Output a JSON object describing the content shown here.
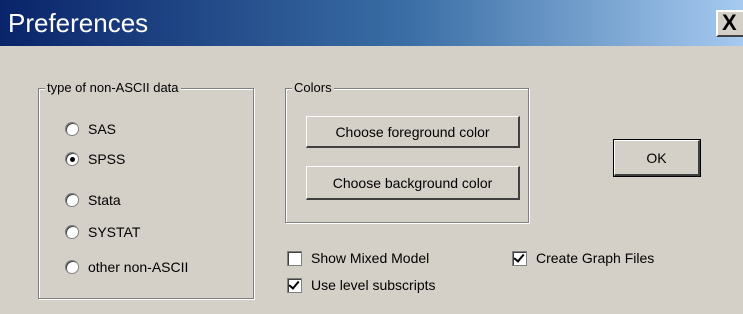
{
  "window": {
    "title": "Preferences",
    "close_glyph": "X"
  },
  "data_type_group": {
    "label": "type of non-ASCII data",
    "options": [
      {
        "label": "SAS",
        "selected": false
      },
      {
        "label": "SPSS",
        "selected": true
      },
      {
        "label": "Stata",
        "selected": false
      },
      {
        "label": "SYSTAT",
        "selected": false
      },
      {
        "label": "other non-ASCII",
        "selected": false
      }
    ]
  },
  "colors_group": {
    "label": "Colors",
    "foreground_button": "Choose foreground color",
    "background_button": "Choose background color"
  },
  "ok_button": "OK",
  "checkboxes": {
    "show_mixed_model": {
      "label": "Show Mixed Model",
      "checked": false
    },
    "use_level_subscripts": {
      "label": "Use level subscripts",
      "checked": true
    },
    "create_graph_files": {
      "label": "Create Graph Files",
      "checked": true
    }
  },
  "colors": {
    "dialog_bg": "#d4d0c8",
    "titlebar_start": "#0a246a",
    "titlebar_end": "#a6caf0"
  }
}
